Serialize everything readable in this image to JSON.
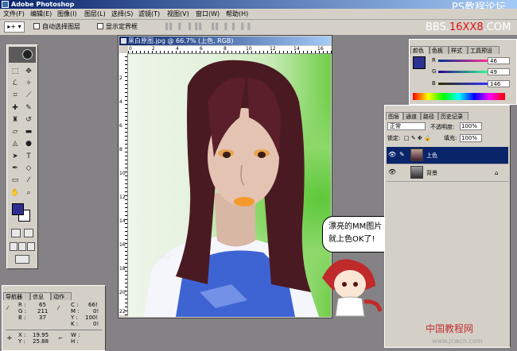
{
  "app": {
    "title": "Adobe Photoshop",
    "watermark_top": "PS教程论坛",
    "watermark_sub_prefix": "BBS.",
    "watermark_sub_mid": "16XX8",
    "watermark_sub_suffix": ".COM"
  },
  "menu": [
    "文件(F)",
    "编辑(E)",
    "图像(I)",
    "图层(L)",
    "选择(S)",
    "滤镜(T)",
    "视图(V)",
    "窗口(W)",
    "帮助(H)"
  ],
  "options": {
    "auto_select_label": "自动选择图层",
    "show_bounds_label": "显示定界框",
    "tool_preset": "▸+ ▾"
  },
  "document": {
    "title": "黑白原图.jpg @ 66.7% (上色, RGB)",
    "ruler_h": [
      "0",
      "2",
      "4",
      "6",
      "8",
      "10",
      "12",
      "14",
      "16"
    ],
    "ruler_v": [
      "2",
      "4",
      "6",
      "8",
      "10",
      "12",
      "14",
      "16",
      "18",
      "20",
      "22"
    ]
  },
  "speech_bubble": {
    "line1": "漂亮的MM图片",
    "line2": "就上色OK了!"
  },
  "photo_watermark": "baby",
  "info_panel": {
    "tabs": [
      "导航器",
      "信息",
      "动作"
    ],
    "r_label": "R :",
    "r_value": "65",
    "g_label": "G :",
    "g_value": "211",
    "b_label": "B :",
    "b_value": "37",
    "c_label": "C :",
    "c_value": "66!",
    "m_label": "M :",
    "m_value": "0!",
    "y_label": "Y :",
    "y_value": "100!",
    "k_label": "K :",
    "k_value": "0!",
    "x_label": "X :",
    "x_value": "19.95",
    "y2_label": "Y :",
    "y2_value": "25.88",
    "w_label": "W :",
    "h_label": "H :"
  },
  "color_panel": {
    "tabs": [
      "颜色",
      "色板",
      "样式",
      "工具预设"
    ],
    "r_label": "R",
    "r_value": "46",
    "g_label": "G",
    "g_value": "49",
    "b_label": "B",
    "b_value": "146",
    "fg_color": "#2e3192"
  },
  "layers_panel": {
    "tabs": [
      "图层",
      "通道",
      "路径",
      "历史记录"
    ],
    "blend_mode": "正常",
    "opacity_label": "不透明度:",
    "opacity_value": "100%",
    "lock_label": "锁定:",
    "fill_label": "填充:",
    "fill_value": "100%",
    "layers": [
      {
        "name": "上色",
        "selected": true
      },
      {
        "name": "背景",
        "selected": false
      }
    ]
  },
  "bottom_watermark": {
    "logo": "中国教程网",
    "url": "www.jcwcn.com"
  }
}
